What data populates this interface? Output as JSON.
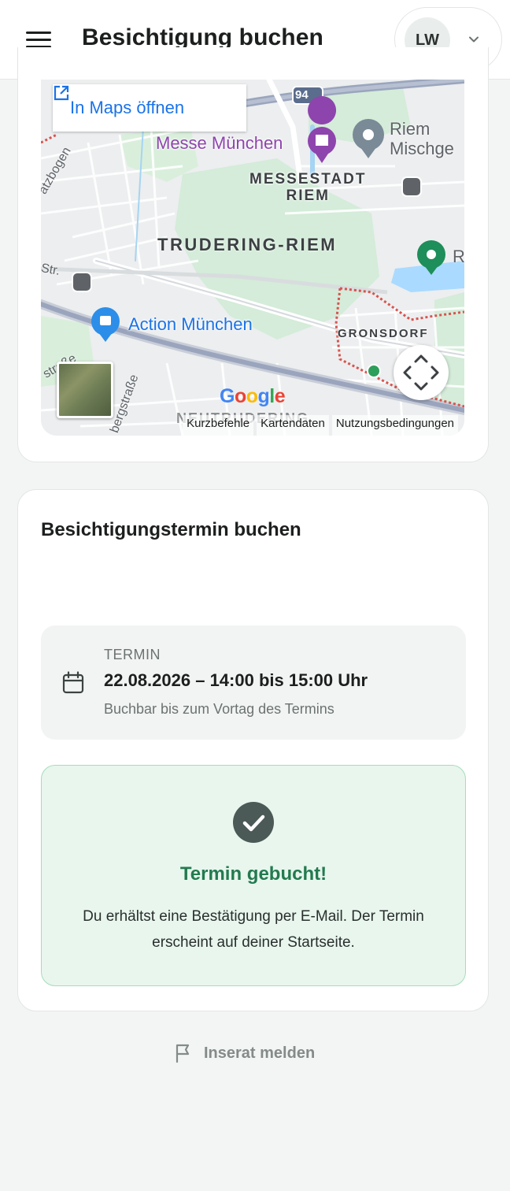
{
  "header": {
    "title": "Besichtigung buchen",
    "avatar_initials": "LW"
  },
  "map": {
    "open_in_maps": "In Maps öffnen",
    "labels": {
      "messe": "Messe München",
      "riem_line1": "Riem",
      "riem_line2": "Mischge",
      "messestadt_line1": "MESSESTADT",
      "messestadt_line2": "RIEM",
      "trudering": "TRUDERING-RIEM",
      "action": "Action München",
      "gronsdorf": "GRONSDORF",
      "neutrudering": "NEUTRUDERING",
      "highway": "94",
      "street_1": "atzbogen",
      "street_2": "Str.",
      "street_3": "straße",
      "street_4": "bergstraße",
      "right_edge": "R"
    },
    "google_logo": [
      "G",
      "o",
      "o",
      "g",
      "l",
      "e"
    ],
    "attribution": [
      "Kurzbefehle",
      "Kartendaten",
      "Nutzungsbedingungen"
    ]
  },
  "booking": {
    "title": "Besichtigungstermin buchen",
    "termin_label": "TERMIN",
    "termin_value": "22.08.2026 – 14:00 bis 15:00 Uhr",
    "termin_note": "Buchbar bis zum Vortag des Termins",
    "success_title": "Termin gebucht!",
    "success_text": "Du erhältst eine Bestätigung per E-Mail. Der Termin erscheint auf deiner Startseite."
  },
  "footer": {
    "report_label": "Inserat melden"
  },
  "colors": {
    "accent_green": "#237a4f",
    "success_bg": "#e8f6ee",
    "map_link_blue": "#1a73e8"
  }
}
